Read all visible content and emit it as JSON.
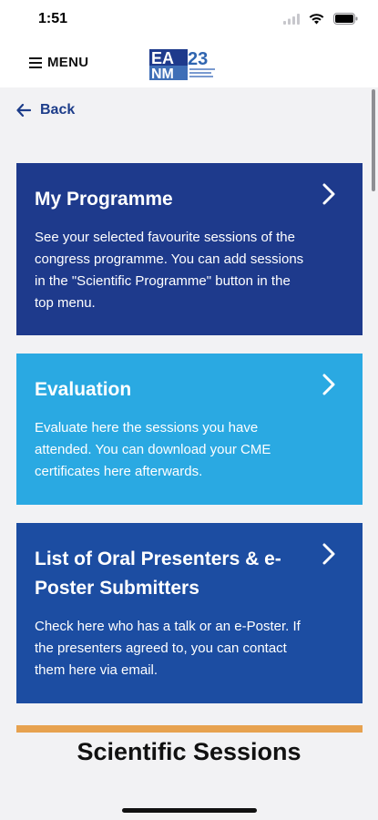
{
  "status_bar": {
    "time": "1:51"
  },
  "header": {
    "menu_label": "MENU",
    "logo_text": "EANM23"
  },
  "back_label": "Back",
  "cards": [
    {
      "title": "My Programme",
      "description": "See your selected favourite sessions of the congress programme. You can add sessions in the \"Scientific Programme\" button in the top menu.",
      "color": "#1e3a8c"
    },
    {
      "title": "Evaluation",
      "description": "Evaluate here the sessions you have attended. You can download your CME certificates here afterwards.",
      "color": "#2aa9e2"
    },
    {
      "title": "List of Oral Presenters & e-Poster Submitters",
      "description": "Check here who has a talk or an e-Poster. If the presenters agreed to, you can contact them here via email.",
      "color": "#1c4da2"
    }
  ],
  "section_title": "Scientific Sessions",
  "accent_orange": "#e7a24f"
}
